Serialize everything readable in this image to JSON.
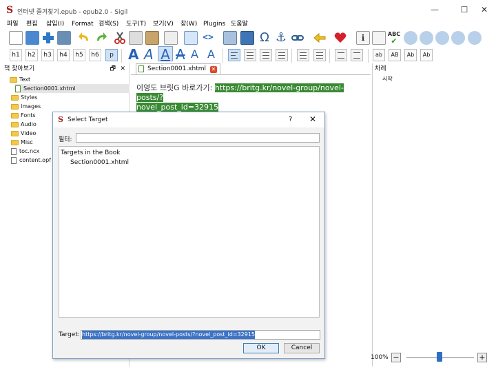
{
  "window": {
    "title": "인터넷 즐겨찾기.epub - epub2.0 - Sigil",
    "minimize": "—",
    "maximize": "☐",
    "close": "✕"
  },
  "menu": [
    "파일",
    "편집",
    "삽입(I)",
    "Format",
    "검색(S)",
    "도구(T)",
    "보기(V)",
    "창(W)",
    "Plugins",
    "도움말"
  ],
  "toolbar2": {
    "headings": [
      "h1",
      "h2",
      "h3",
      "h4",
      "h5",
      "h6",
      "p"
    ],
    "font_a": [
      "A",
      "A",
      "A",
      "A",
      "A",
      "A"
    ],
    "case_buttons": [
      "ab",
      "AB",
      "Ab",
      "Ab"
    ]
  },
  "book_browser": {
    "title": "책 찾아보기",
    "items": [
      {
        "label": "Text",
        "type": "folder"
      },
      {
        "label": "Section0001.xhtml",
        "type": "file"
      },
      {
        "label": "Styles",
        "type": "folder"
      },
      {
        "label": "Images",
        "type": "folder"
      },
      {
        "label": "Fonts",
        "type": "folder"
      },
      {
        "label": "Audio",
        "type": "folder"
      },
      {
        "label": "Video",
        "type": "folder"
      },
      {
        "label": "Misc",
        "type": "folder"
      },
      {
        "label": "toc.ncx",
        "type": "file"
      },
      {
        "label": "content.opf",
        "type": "file"
      }
    ],
    "float_icon": "🗗",
    "close_icon": "✕"
  },
  "editor": {
    "tab_label": "Section0001.xhtml",
    "tab_close": "✕",
    "text_prefix": "이영도 브릿G 바로가기: ",
    "link_text_line1": "https://britg.kr/novel-group/novel-posts/?",
    "link_text_line2": "novel_post_id=32915"
  },
  "toc": {
    "title": "차례",
    "items": [
      "시작"
    ]
  },
  "status": {
    "zoom": "100%",
    "zoom_out": "−",
    "zoom_in": "+"
  },
  "dialog": {
    "title": "Select Target",
    "help": "?",
    "close": "✕",
    "filter_label": "필터:",
    "filter_value": "",
    "list_header": "Targets in the Book",
    "list_items": [
      "Section0001.xhtml"
    ],
    "target_label": "Target:",
    "target_value": "https://britg.kr/novel-group/novel-posts/?novel_post_id=32915",
    "ok": "OK",
    "cancel": "Cancel"
  },
  "colors": {
    "link_highlight": "#3a8a34",
    "dialog_border": "#7a9fc9",
    "selection": "#3a73c7"
  }
}
